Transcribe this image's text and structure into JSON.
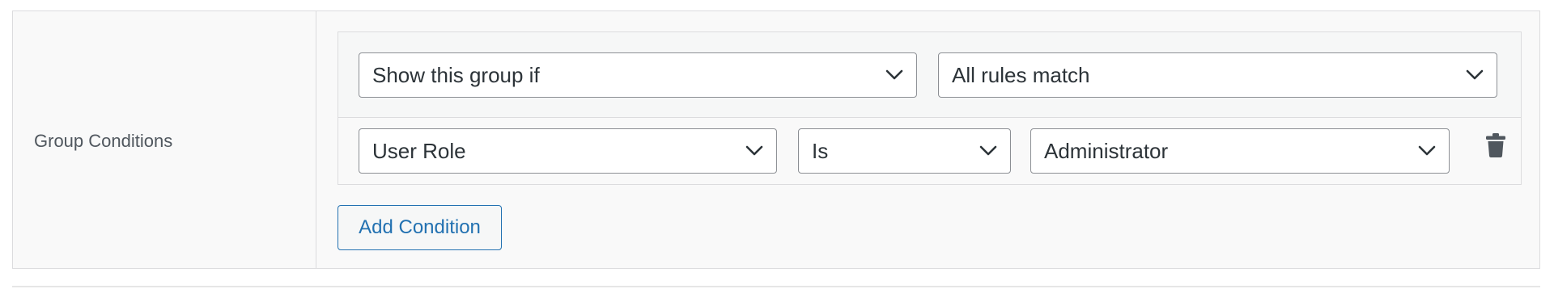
{
  "group": {
    "label": "Group Conditions"
  },
  "rules": {
    "visibility_select": {
      "value": "Show this group if"
    },
    "match_select": {
      "value": "All rules match"
    },
    "conditions": [
      {
        "field": "User Role",
        "operator": "Is",
        "value": "Administrator"
      }
    ],
    "add_condition_label": "Add Condition"
  },
  "icons": {
    "dropdown": "chevron-down-icon",
    "delete": "trash-icon"
  },
  "colors": {
    "accent": "#2271b1",
    "border": "#dcdcde",
    "text": "#2c3338"
  }
}
